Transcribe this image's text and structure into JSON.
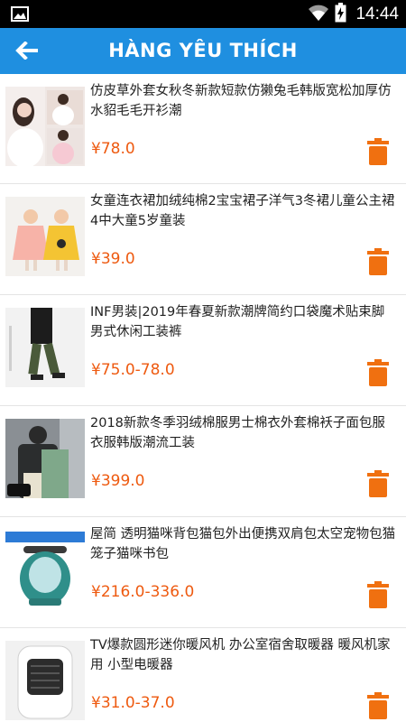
{
  "status_bar": {
    "time": "14:44",
    "icons": [
      "image-icon",
      "wifi-icon",
      "battery-charging-icon"
    ]
  },
  "header": {
    "title": "HÀNG YÊU THÍCH",
    "back_icon": "arrow-left-icon",
    "background_color": "#1f8fe0"
  },
  "colors": {
    "price": "#ee5a10",
    "delete_icon": "#f07010"
  },
  "items": [
    {
      "name": "仿皮草外套女秋冬新款短款仿獭兔毛韩版宽松加厚仿水貂毛毛开衫潮",
      "price": "¥78.0"
    },
    {
      "name": "女童连衣裙加绒纯棉2宝宝裙子洋气3冬裙儿童公主裙4中大童5岁童装",
      "price": "¥39.0"
    },
    {
      "name": "INF男装|2019年春夏新款潮牌简约口袋魔术贴束脚男式休闲工装裤",
      "price": "¥75.0-78.0"
    },
    {
      "name": "2018新款冬季羽绒棉服男士棉衣外套棉袄子面包服衣服韩版潮流工装",
      "price": "¥399.0"
    },
    {
      "name": "屋简 透明猫咪背包猫包外出便携双肩包太空宠物包猫笼子猫咪书包",
      "price": "¥216.0-336.0"
    },
    {
      "name": "TV爆款圆形迷你暖风机 办公室宿舍取暖器 暖风机家用 小型电暖器",
      "price": "¥31.0-37.0"
    }
  ]
}
